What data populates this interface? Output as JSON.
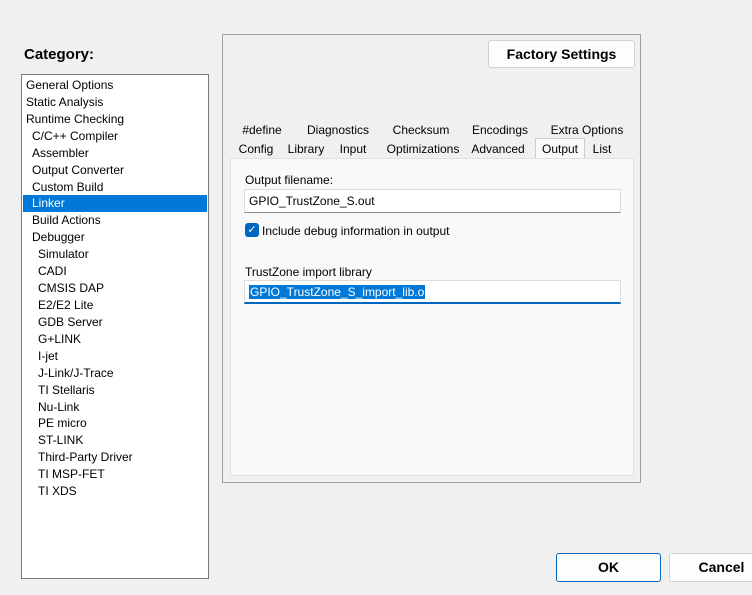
{
  "category": {
    "label": "Category:",
    "items": [
      "General Options",
      "Static Analysis",
      "Runtime Checking",
      "C/C++ Compiler",
      "Assembler",
      "Output Converter",
      "Custom Build",
      "Linker",
      "Build Actions",
      "Debugger",
      "Simulator",
      "CADI",
      "CMSIS DAP",
      "E2/E2 Lite",
      "GDB Server",
      "G+LINK",
      "I-jet",
      "J-Link/J-Trace",
      "TI Stellaris",
      "Nu-Link",
      "PE micro",
      "ST-LINK",
      "Third-Party Driver",
      "TI MSP-FET",
      "TI XDS"
    ],
    "selected": "Linker"
  },
  "factory_settings_label": "Factory Settings",
  "tabs": {
    "row1": [
      "#define",
      "Diagnostics",
      "Checksum",
      "Encodings",
      "Extra Options"
    ],
    "row2": [
      "Config",
      "Library",
      "Input",
      "Optimizations",
      "Advanced",
      "Output",
      "List"
    ],
    "active": "Output"
  },
  "output": {
    "filename_label": "Output filename:",
    "filename_value": "GPIO_TrustZone_S.out",
    "debug_label": "Include debug information in output",
    "debug_checked": true,
    "import_label": "TrustZone import library",
    "import_value": "GPIO_TrustZone_S_import_lib.o"
  },
  "buttons": {
    "ok": "OK",
    "cancel": "Cancel"
  },
  "colors": {
    "accent": "#0078d7",
    "focus": "#0067c0"
  }
}
